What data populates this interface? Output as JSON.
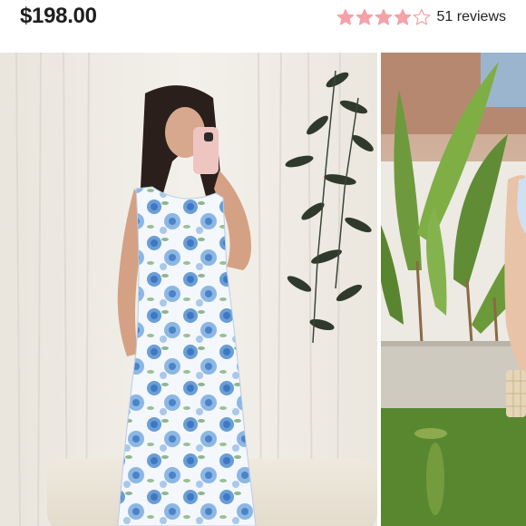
{
  "product": {
    "price": "$198.00",
    "rating": 4,
    "rating_max": 5,
    "reviews_label": "51 reviews",
    "star_color_filled": "#f4a2a8",
    "star_color_empty": "#ffffff",
    "star_outline": "#f4a2a8"
  },
  "gallery": {
    "images": [
      {
        "subject": "model-mirror-selfie-blue-floral-maxi-dress"
      },
      {
        "subject": "model-outdoor-patio-with-banana-plants"
      }
    ]
  }
}
